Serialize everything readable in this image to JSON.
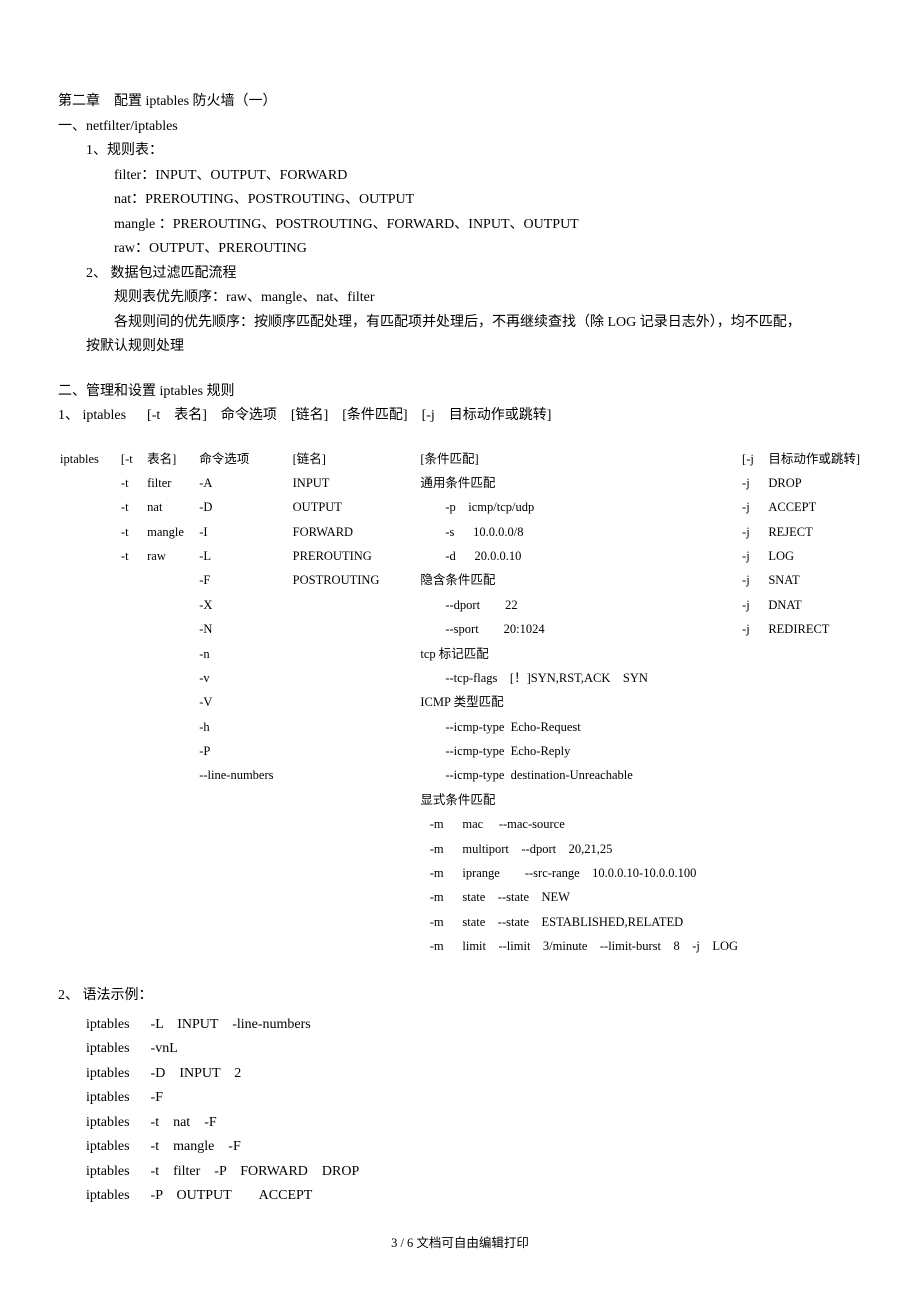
{
  "title": "第二章　配置 iptables 防火墙（一）",
  "sectionA": {
    "heading": "一、netfilter/iptables",
    "item1": {
      "label": "1、规则表：",
      "lines": [
        "filter：INPUT、OUTPUT、FORWARD",
        "nat：PREROUTING、POSTROUTING、OUTPUT",
        "mangle ：PREROUTING、POSTROUTING、FORWARD、INPUT、OUTPUT",
        "raw：OUTPUT、PREROUTING"
      ]
    },
    "item2": {
      "label": "2、 数据包过滤匹配流程",
      "line1": "规则表优先顺序：raw、mangle、nat、filter",
      "line2a": "各规则间的优先顺序：按顺序匹配处理，有匹配项并处理后，不再继续查找（除 LOG 记录日志外），均不匹配，",
      "line2b": "按默认规则处理"
    }
  },
  "sectionB": {
    "heading": "二、管理和设置 iptables 规则",
    "syntax": "1、 iptables      [-t    表名]    命令选项    [链名]    [条件匹配]    [-j    目标动作或跳转]"
  },
  "cmdTable": {
    "headers": {
      "cmd": "iptables",
      "tflag": "[-t",
      "tname": "表名]",
      "opt": "命令选项",
      "chain": "[链名]",
      "cond": "[条件匹配]",
      "jflag": "[-j",
      "targ": "目标动作或跳转]"
    },
    "rows": [
      {
        "tflag": "-t",
        "tname": "filter",
        "opt": "-A",
        "chain": "INPUT",
        "cond": "通用条件匹配",
        "jflag": "-j",
        "targ": "DROP"
      },
      {
        "tflag": "-t",
        "tname": "nat",
        "opt": "-D",
        "chain": "OUTPUT",
        "cond": "        -p    icmp/tcp/udp",
        "jflag": "-j",
        "targ": "ACCEPT"
      },
      {
        "tflag": "-t",
        "tname": "mangle",
        "opt": "-I",
        "chain": "FORWARD",
        "cond": "        -s      10.0.0.0/8",
        "jflag": "-j",
        "targ": "REJECT"
      },
      {
        "tflag": "-t",
        "tname": "raw",
        "opt": "-L",
        "chain": "PREROUTING",
        "cond": "        -d      20.0.0.10",
        "jflag": "-j",
        "targ": "LOG"
      },
      {
        "tflag": "",
        "tname": "",
        "opt": "-F",
        "chain": "POSTROUTING",
        "cond": "隐含条件匹配",
        "jflag": "-j",
        "targ": "SNAT"
      },
      {
        "tflag": "",
        "tname": "",
        "opt": "-X",
        "chain": "",
        "cond": "        --dport        22",
        "jflag": "-j",
        "targ": "DNAT"
      },
      {
        "tflag": "",
        "tname": "",
        "opt": "-N",
        "chain": "",
        "cond": "        --sport        20:1024",
        "jflag": "-j",
        "targ": "REDIRECT"
      },
      {
        "tflag": "",
        "tname": "",
        "opt": "-n",
        "chain": "",
        "cond": "tcp 标记匹配",
        "jflag": "",
        "targ": ""
      },
      {
        "tflag": "",
        "tname": "",
        "opt": "-v",
        "chain": "",
        "cond": "        --tcp-flags    [！]SYN,RST,ACK    SYN",
        "jflag": "",
        "targ": ""
      },
      {
        "tflag": "",
        "tname": "",
        "opt": "-V",
        "chain": "",
        "cond": "ICMP 类型匹配",
        "jflag": "",
        "targ": ""
      },
      {
        "tflag": "",
        "tname": "",
        "opt": "-h",
        "chain": "",
        "cond": "        --icmp-type  Echo-Request",
        "jflag": "",
        "targ": ""
      },
      {
        "tflag": "",
        "tname": "",
        "opt": "-P",
        "chain": "",
        "cond": "        --icmp-type  Echo-Reply",
        "jflag": "",
        "targ": ""
      },
      {
        "tflag": "",
        "tname": "",
        "opt": "--line-numbers",
        "chain": "",
        "cond": "        --icmp-type  destination-Unreachable",
        "jflag": "",
        "targ": ""
      },
      {
        "tflag": "",
        "tname": "",
        "opt": "",
        "chain": "",
        "cond": "显式条件匹配",
        "jflag": "",
        "targ": ""
      },
      {
        "tflag": "",
        "tname": "",
        "opt": "",
        "chain": "",
        "cond": "   -m      mac     --mac-source",
        "jflag": "",
        "targ": ""
      },
      {
        "tflag": "",
        "tname": "",
        "opt": "",
        "chain": "",
        "cond": "   -m      multiport    --dport    20,21,25",
        "jflag": "",
        "targ": ""
      },
      {
        "tflag": "",
        "tname": "",
        "opt": "",
        "chain": "",
        "cond": "   -m      iprange        --src-range    10.0.0.10-10.0.0.100",
        "jflag": "",
        "targ": ""
      },
      {
        "tflag": "",
        "tname": "",
        "opt": "",
        "chain": "",
        "cond": "   -m      state    --state    NEW",
        "jflag": "",
        "targ": ""
      },
      {
        "tflag": "",
        "tname": "",
        "opt": "",
        "chain": "",
        "cond": "   -m      state    --state    ESTABLISHED,RELATED",
        "jflag": "",
        "targ": ""
      },
      {
        "tflag": "",
        "tname": "",
        "opt": "",
        "chain": "",
        "cond": "   -m      limit    --limit    3/minute    --limit-burst    8    -j    LOG",
        "jflag": "",
        "targ": ""
      }
    ]
  },
  "examples": {
    "heading": "2、 语法示例：",
    "lines": [
      "iptables      -L    INPUT    -line-numbers",
      "iptables      -vnL",
      "iptables      -D    INPUT    2",
      "iptables      -F",
      "iptables      -t    nat    -F",
      "iptables      -t    mangle    -F",
      "iptables      -t    filter    -P    FORWARD    DROP",
      "iptables      -P    OUTPUT        ACCEPT"
    ]
  },
  "footer": "3 / 6 文档可自由编辑打印"
}
